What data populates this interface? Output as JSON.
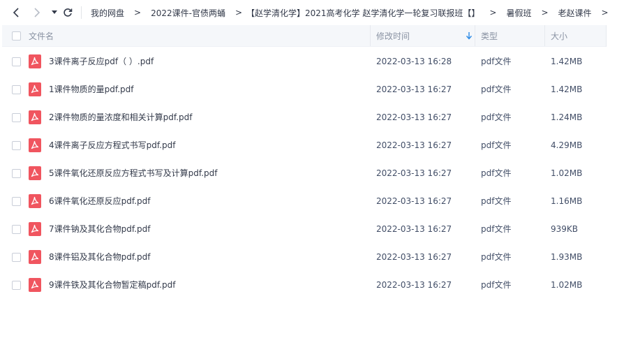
{
  "toolbar": {
    "back_icon": "chevron-left-icon",
    "forward_icon": "chevron-right-icon",
    "dropdown_icon": "caret-down-icon",
    "refresh_icon": "refresh-icon"
  },
  "breadcrumb": {
    "items": [
      "我的网盘",
      "2022课件-官债两蛹",
      "【赵学清化学】2021高考化学 赵学清化学一轮复习联报班【】",
      "暑假班",
      "老赵课件"
    ],
    "separator": ">"
  },
  "header": {
    "name": "文件名",
    "modified": "修改时间",
    "type": "类型",
    "size": "大小",
    "sort_icon": "sort-down-arrow-icon"
  },
  "files": [
    {
      "name": "3课件离子反应pdf（ ）.pdf",
      "modified": "2022-03-13 16:28",
      "type": "pdf文件",
      "size": "1.42MB"
    },
    {
      "name": "1课件物质的量pdf.pdf",
      "modified": "2022-03-13 16:27",
      "type": "pdf文件",
      "size": "1.42MB"
    },
    {
      "name": "2课件物质的量浓度和相关计算pdf.pdf",
      "modified": "2022-03-13 16:27",
      "type": "pdf文件",
      "size": "1.24MB"
    },
    {
      "name": "4课件离子反应方程式书写pdf.pdf",
      "modified": "2022-03-13 16:27",
      "type": "pdf文件",
      "size": "4.29MB"
    },
    {
      "name": "5课件氧化还原反应方程式书写及计算pdf.pdf",
      "modified": "2022-03-13 16:27",
      "type": "pdf文件",
      "size": "1.02MB"
    },
    {
      "name": "6课件氧化还原反应pdf.pdf",
      "modified": "2022-03-13 16:27",
      "type": "pdf文件",
      "size": "1.16MB"
    },
    {
      "name": "7课件钠及其化合物pdf.pdf",
      "modified": "2022-03-13 16:27",
      "type": "pdf文件",
      "size": "939KB"
    },
    {
      "name": "8课件铝及其化合物pdf.pdf",
      "modified": "2022-03-13 16:27",
      "type": "pdf文件",
      "size": "1.93MB"
    },
    {
      "name": "9课件铁及其化合物暂定稿pdf.pdf",
      "modified": "2022-03-13 16:27",
      "type": "pdf文件",
      "size": "1.02MB"
    }
  ],
  "colors": {
    "pdf_icon": "#f0555f",
    "sort_arrow": "#2b8ae6",
    "header_bg": "#f5f7fa"
  }
}
